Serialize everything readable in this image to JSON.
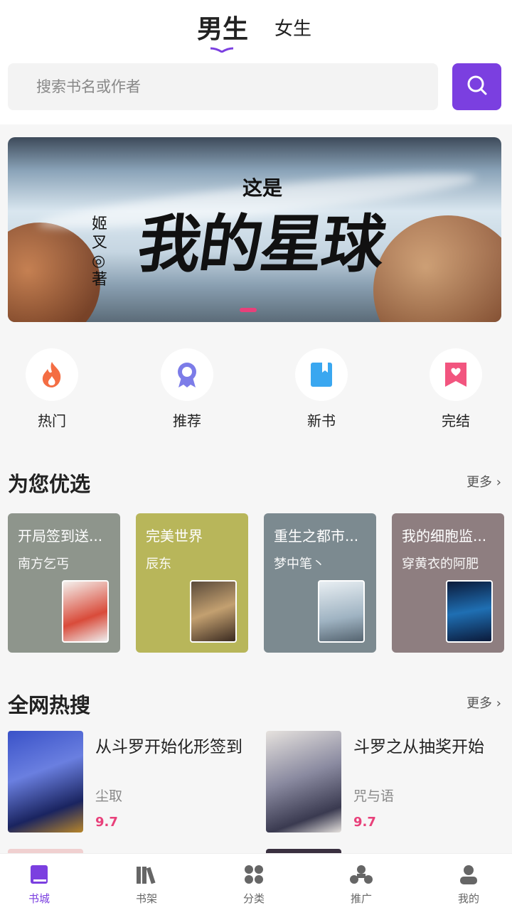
{
  "gender_tabs": {
    "male": "男生",
    "female": "女生",
    "active": "male"
  },
  "search": {
    "placeholder": "搜索书名或作者",
    "icon": "search-icon"
  },
  "banner": {
    "small_title": "这是",
    "big_title": "我的星球",
    "author": "姬叉◎著",
    "indicator_active": 1,
    "indicator_count": 1
  },
  "quick_links": [
    {
      "label": "热门",
      "icon": "flame-icon",
      "color": "#f46d43"
    },
    {
      "label": "推荐",
      "icon": "award-icon",
      "color": "#7c7ce8"
    },
    {
      "label": "新书",
      "icon": "book-icon",
      "color": "#3aa7f0"
    },
    {
      "label": "完结",
      "icon": "heart-bookmark-icon",
      "color": "#f2557f"
    }
  ],
  "picks": {
    "title": "为您优选",
    "more": "更多",
    "items": [
      {
        "title": "开局签到送...",
        "author": "南方乞丐",
        "bg": "#8e958c"
      },
      {
        "title": "完美世界",
        "author": "辰东",
        "bg": "#b8b65a"
      },
      {
        "title": "重生之都市...",
        "author": "梦中笔丶",
        "bg": "#7c8a90"
      },
      {
        "title": "我的细胞监...",
        "author": "穿黄衣的阿肥",
        "bg": "#8e7e80"
      }
    ]
  },
  "hot": {
    "title": "全网热搜",
    "more": "更多",
    "items": [
      {
        "title": "从斗罗开始化形签到",
        "author": "尘取",
        "score": "9.7"
      },
      {
        "title": "斗罗之从抽奖开始",
        "author": "咒与语",
        "score": "9.7"
      }
    ]
  },
  "tabbar": [
    {
      "label": "书城",
      "icon": "bookstore-icon",
      "active": true
    },
    {
      "label": "书架",
      "icon": "bookshelf-icon",
      "active": false
    },
    {
      "label": "分类",
      "icon": "category-icon",
      "active": false
    },
    {
      "label": "推广",
      "icon": "share-icon",
      "active": false
    },
    {
      "label": "我的",
      "icon": "profile-icon",
      "active": false
    }
  ],
  "colors": {
    "accent": "#7b3fe0",
    "score": "#e8407a"
  }
}
